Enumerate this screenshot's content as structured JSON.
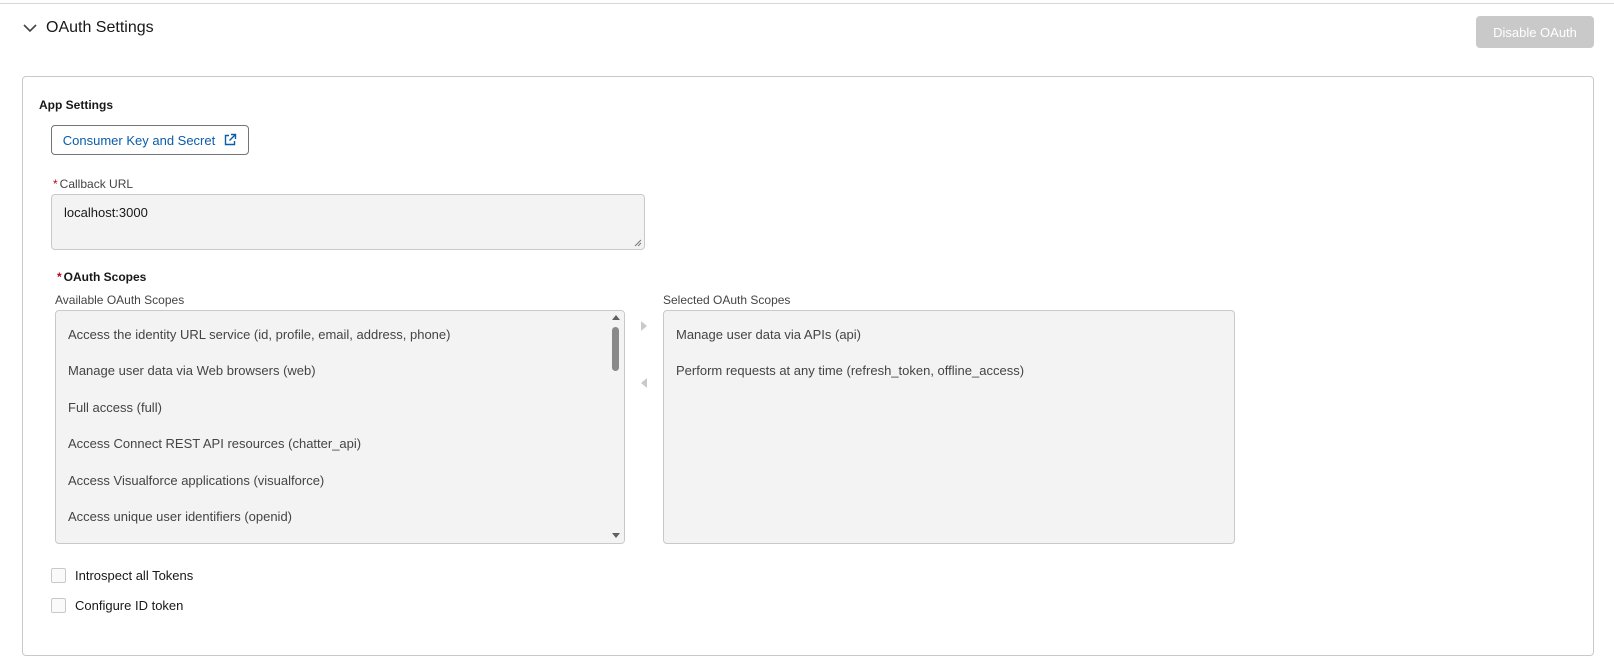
{
  "section": {
    "title": "OAuth Settings",
    "disable_label": "Disable OAuth"
  },
  "app_settings": {
    "title": "App Settings",
    "consumer_button_label": "Consumer Key and Secret"
  },
  "callback": {
    "required_marker": "*",
    "label": "Callback URL",
    "value": "localhost:3000"
  },
  "scopes": {
    "required_marker": "*",
    "title": "OAuth Scopes",
    "available_label": "Available OAuth Scopes",
    "selected_label": "Selected OAuth Scopes",
    "available": [
      "Access the identity URL service (id, profile, email, address, phone)",
      "Manage user data via Web browsers (web)",
      "Full access (full)",
      "Access Connect REST API resources (chatter_api)",
      "Access Visualforce applications (visualforce)",
      "Access unique user identifiers (openid)"
    ],
    "selected": [
      "Manage user data via APIs (api)",
      "Perform requests at any time (refresh_token, offline_access)"
    ]
  },
  "options": {
    "introspect_label": "Introspect all Tokens",
    "introspect_checked": false,
    "id_token_label": "Configure ID token",
    "id_token_checked": false
  },
  "colors": {
    "link_blue": "#0b5cab",
    "required_red": "#ba0517",
    "disabled_button": "#c9c9c9",
    "field_background": "#f3f3f3"
  }
}
